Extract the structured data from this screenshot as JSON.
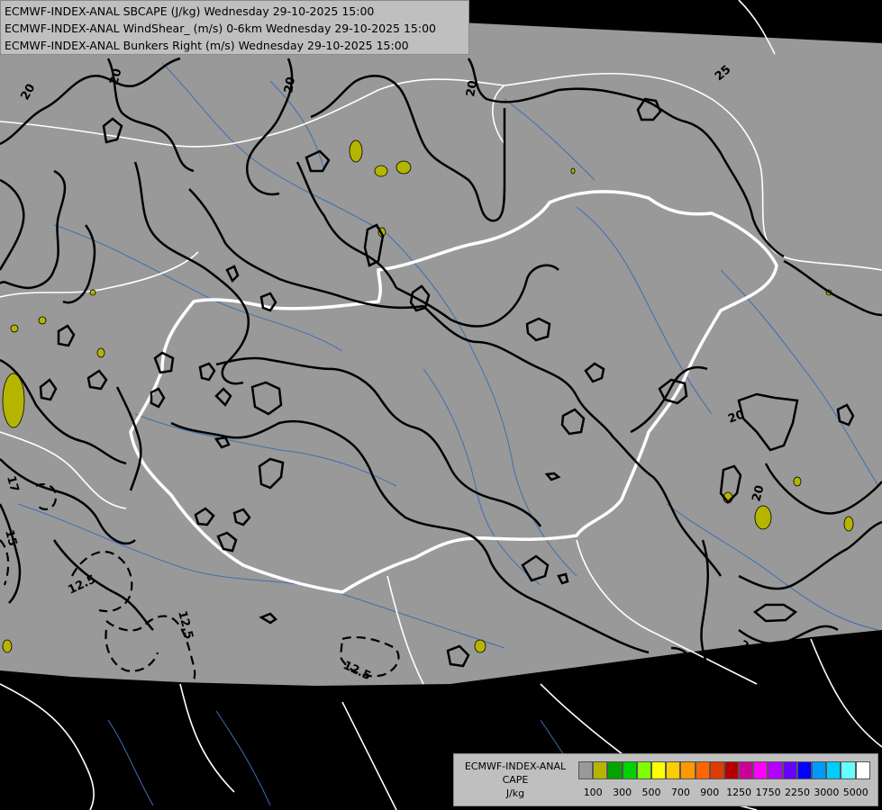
{
  "header": {
    "lines": [
      "ECMWF-INDEX-ANAL SBCAPE (J/kg) Wednesday 29-10-2025 15:00",
      "ECMWF-INDEX-ANAL WindShear_ (m/s) 0-6km Wednesday 29-10-2025 15:00",
      "ECMWF-INDEX-ANAL Bunkers Right (m/s) Wednesday 29-10-2025 15:00"
    ]
  },
  "legend": {
    "title_lines": [
      "ECMWF-INDEX-ANAL",
      "CAPE",
      "J/kg"
    ],
    "swatch_colors": [
      "#999999",
      "#b5b500",
      "#00a500",
      "#00d200",
      "#7fff00",
      "#ffff00",
      "#ffcc00",
      "#ff9900",
      "#ff6600",
      "#e03c00",
      "#b40000",
      "#cc0099",
      "#ff00ff",
      "#b400ff",
      "#6600ff",
      "#0000ff",
      "#0099ff",
      "#00ccff",
      "#66ffff",
      "#ffffff"
    ],
    "tick_labels": [
      "100",
      "300",
      "500",
      "700",
      "900",
      "1250",
      "1750",
      "2250",
      "3000",
      "5000"
    ]
  },
  "map": {
    "colors": {
      "domain": "#999999",
      "outside": "#000000",
      "border": "#ffffff",
      "river": "#3d6fb0",
      "contour": "#000000",
      "cape_fill": "#b5b500"
    },
    "contour_labels": [
      {
        "text": "20"
      },
      {
        "text": "20"
      },
      {
        "text": "20"
      },
      {
        "text": "20"
      },
      {
        "text": "25"
      },
      {
        "text": "20"
      },
      {
        "text": "20"
      },
      {
        "text": "20"
      },
      {
        "text": "17"
      },
      {
        "text": "17"
      },
      {
        "text": "15"
      },
      {
        "text": "12.5"
      },
      {
        "text": "12.5"
      },
      {
        "text": "12.5"
      }
    ]
  }
}
